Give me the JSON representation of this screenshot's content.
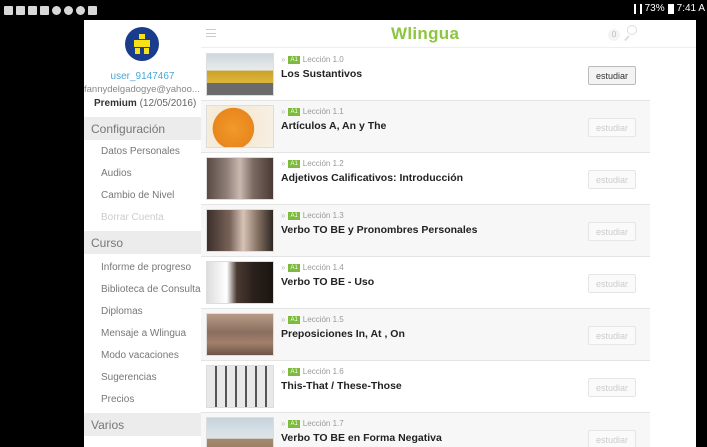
{
  "statusbar": {
    "battery_text": "73%",
    "time": "7:41 A"
  },
  "colors": {
    "brand_green": "#8cc63f",
    "username_blue": "#4aa7d6",
    "level_badge_green": "#7dbb3d"
  },
  "user": {
    "name": "user_9147467",
    "email": "fannydelgadogye@yahoo...",
    "plan": "Premium",
    "plan_date": "(12/05/2016)"
  },
  "sidebar": {
    "config_title": "Configuración",
    "config_items": [
      "Datos Personales",
      "Audios",
      "Cambio de Nivel",
      "Borrar Cuenta"
    ],
    "course_title": "Curso",
    "course_items": [
      "Informe de progreso",
      "Biblioteca de Consulta",
      "Diplomas",
      "Mensaje a Wlingua",
      "Modo vacaciones",
      "Sugerencias",
      "Precios"
    ],
    "other_title": "Varios"
  },
  "topbar": {
    "logo": "Wlingua",
    "notifications": "0"
  },
  "lessons": [
    {
      "level": "A1",
      "number": "Lección 1.0",
      "title": "Los Sustantivos",
      "button": "estudiar",
      "active": true
    },
    {
      "level": "A1",
      "number": "Lección 1.1",
      "title": "Artículos A, An y The",
      "button": "estudiar",
      "active": false
    },
    {
      "level": "A1",
      "number": "Lección 1.2",
      "title": "Adjetivos Calificativos: Introducción",
      "button": "estudiar",
      "active": false
    },
    {
      "level": "A1",
      "number": "Lección 1.3",
      "title": "Verbo TO BE y Pronombres Personales",
      "button": "estudiar",
      "active": false
    },
    {
      "level": "A1",
      "number": "Lección 1.4",
      "title": "Verbo TO BE - Uso",
      "button": "estudiar",
      "active": false
    },
    {
      "level": "A1",
      "number": "Lección 1.5",
      "title": "Preposiciones In, At , On",
      "button": "estudiar",
      "active": false
    },
    {
      "level": "A1",
      "number": "Lección 1.6",
      "title": "This-That / These-Those",
      "button": "estudiar",
      "active": false
    },
    {
      "level": "A1",
      "number": "Lección 1.7",
      "title": "Verbo TO BE en Forma Negativa",
      "button": "estudiar",
      "active": false
    }
  ]
}
